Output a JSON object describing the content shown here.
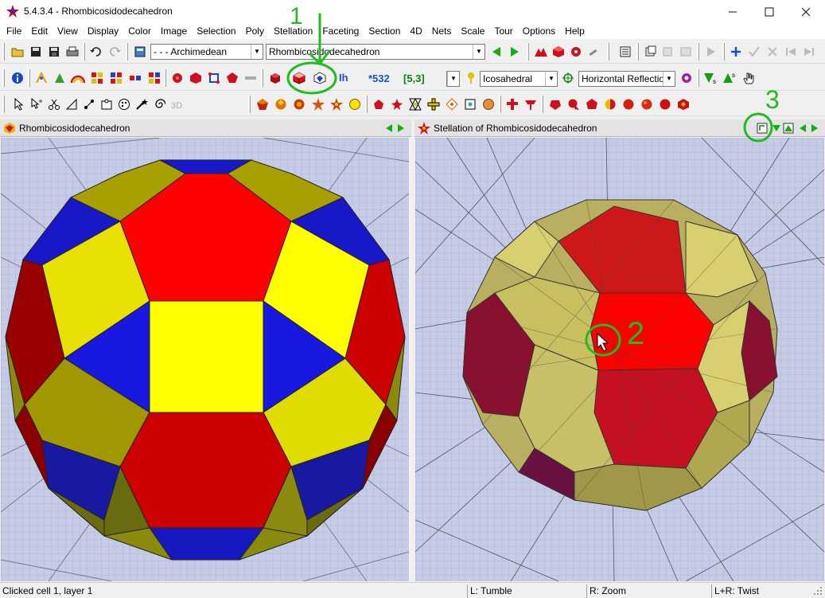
{
  "window": {
    "title": "5.4.3.4 - Rhombicosidodecahedron",
    "minimize_icon": "minimize-icon",
    "maximize_icon": "maximize-icon",
    "close_icon": "close-icon"
  },
  "menu": [
    "File",
    "Edit",
    "View",
    "Display",
    "Color",
    "Image",
    "Selection",
    "Poly",
    "Stellation",
    "Faceting",
    "Section",
    "4D",
    "Nets",
    "Scale",
    "Tour",
    "Options",
    "Help"
  ],
  "toolbar1": {
    "family_combo": "- - - Archimedean",
    "polyhedron_combo": "Rhombicosidodecahedron"
  },
  "toolbar2": {
    "symmetry_label": "Ih",
    "orbifold": "*532",
    "schlafli": "[5,3]",
    "symmetry_combo": "Icosahedral",
    "reflection_combo": "Horizontal Reflection",
    "operator_label_1": "s",
    "operator_label_2": "s"
  },
  "panels": {
    "left_title": "Rhombicosidodecahedron",
    "right_title": "Stellation of Rhombicosidodecahedron"
  },
  "annotations": {
    "mark_1": "1",
    "mark_2": "2",
    "mark_3": "3"
  },
  "statusbar": {
    "message": "Clicked cell 1, layer 1",
    "left_mouse": "L: Tumble",
    "right_mouse": "R: Zoom",
    "both_mouse": "L+R: Twist"
  },
  "colors": {
    "face_red": "#ff0000",
    "face_yellow": "#ffff00",
    "face_blue": "#0000ff",
    "annotation_green": "#22bb22",
    "background_grid": "#c6cbe6"
  }
}
